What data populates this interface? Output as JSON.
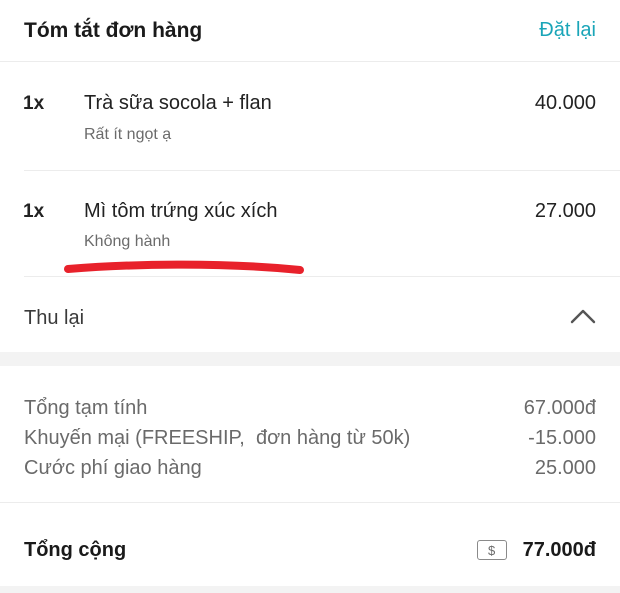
{
  "header": {
    "title": "Tóm tắt đơn hàng",
    "reset_label": "Đặt lại"
  },
  "items": [
    {
      "qty": "1x",
      "name": "Trà sữa socola + flan",
      "note": "Rất ít ngọt ạ",
      "price": "40.000"
    },
    {
      "qty": "1x",
      "name": "Mì tôm trứng xúc xích",
      "note": "Không hành",
      "price": "27.000"
    }
  ],
  "collapse": {
    "label": "Thu lại",
    "icon": "chevron-up-icon"
  },
  "summary": [
    {
      "label": "Tổng tạm tính",
      "value": "67.000đ"
    },
    {
      "label": "Khuyến mại (FREESHIP,  đơn hàng từ 50k)",
      "value": "-15.000"
    },
    {
      "label": "Cước phí giao hàng",
      "value": "25.000"
    }
  ],
  "total": {
    "label": "Tổng cộng",
    "value": "77.000đ",
    "icon_symbol": "$",
    "icon": "cash-icon"
  },
  "colors": {
    "accent": "#1aa5b8",
    "annotation": "#e8212b"
  }
}
